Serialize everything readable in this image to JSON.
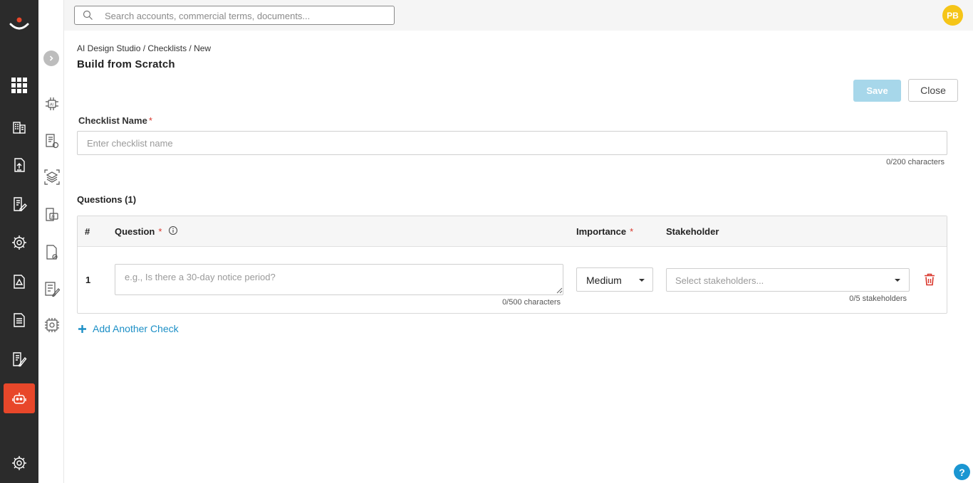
{
  "topbar": {
    "search_placeholder": "Search accounts, commercial terms, documents...",
    "avatar_initials": "PB"
  },
  "breadcrumb": "AI Design Studio / Checklists / New",
  "page_title": "Build from Scratch",
  "actions": {
    "save_label": "Save",
    "close_label": "Close"
  },
  "checklist_name": {
    "label": "Checklist Name",
    "required_mark": "*",
    "placeholder": "Enter checklist name",
    "count": "0/200 characters"
  },
  "questions": {
    "heading": "Questions (1)",
    "columns": {
      "num": "#",
      "question": "Question",
      "importance": "Importance",
      "stakeholder": "Stakeholder"
    },
    "rows": [
      {
        "num": "1",
        "question_placeholder": "e.g., Is there a 30-day notice period?",
        "question_count": "0/500 characters",
        "importance": "Medium",
        "stakeholder_placeholder": "Select stakeholders...",
        "stakeholder_count": "0/5 stakeholders"
      }
    ],
    "add_label": "Add Another Check"
  },
  "help_label": "?",
  "colors": {
    "rail": "#2b2b2b",
    "accent": "#e8472a",
    "link": "#1c8fc6",
    "save_disabled": "#a7d7ea",
    "required": "#d9362b",
    "delete": "#d9362b"
  }
}
